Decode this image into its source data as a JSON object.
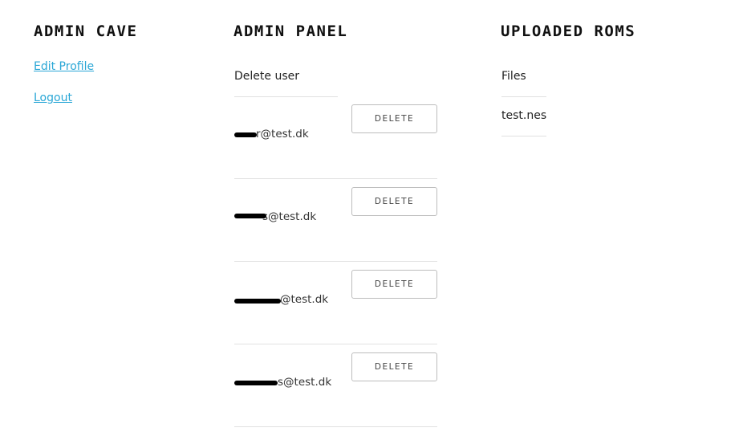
{
  "sidebar": {
    "title": "ADMIN CAVE",
    "links": [
      "Edit Profile",
      "Logout"
    ]
  },
  "admin_panel": {
    "title": "ADMIN PANEL",
    "subtitle": "Delete user",
    "button_label": "DELETE",
    "users": [
      "r@test.dk",
      "s@test.dk",
      "@test.dk",
      "s@test.dk"
    ]
  },
  "roms": {
    "title": "UPLOADED ROMS",
    "subtitle": "Files",
    "files": [
      "test.nes"
    ]
  },
  "colors": {
    "link": "#2aa7d6",
    "divider": "#e1e1e1",
    "redaction": "#000000"
  }
}
